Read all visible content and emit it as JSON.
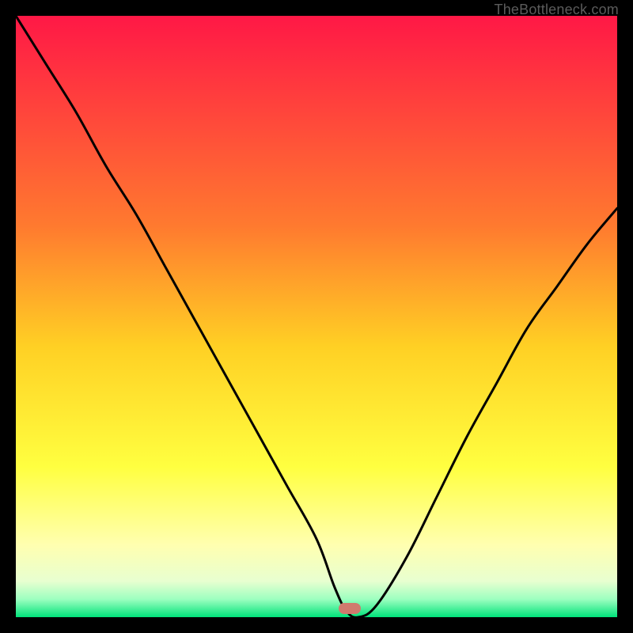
{
  "watermark": "TheBottleneck.com",
  "chart_data": {
    "type": "line",
    "title": "",
    "xlabel": "",
    "ylabel": "",
    "xlim": [
      0,
      100
    ],
    "ylim": [
      0,
      100
    ],
    "gradient_stops": [
      {
        "offset": 0,
        "color": "#ff1846"
      },
      {
        "offset": 35,
        "color": "#ff7a2f"
      },
      {
        "offset": 55,
        "color": "#ffd024"
      },
      {
        "offset": 75,
        "color": "#ffff40"
      },
      {
        "offset": 88,
        "color": "#ffffb0"
      },
      {
        "offset": 94,
        "color": "#e8ffd0"
      },
      {
        "offset": 97,
        "color": "#9dffc0"
      },
      {
        "offset": 100,
        "color": "#00e37a"
      }
    ],
    "series": [
      {
        "name": "bottleneck-curve",
        "x": [
          0,
          5,
          10,
          15,
          20,
          25,
          30,
          35,
          40,
          45,
          50,
          53,
          55,
          57,
          60,
          65,
          70,
          75,
          80,
          85,
          90,
          95,
          100
        ],
        "values": [
          100,
          92,
          84,
          75,
          67,
          58,
          49,
          40,
          31,
          22,
          13,
          5,
          1,
          0,
          2,
          10,
          20,
          30,
          39,
          48,
          55,
          62,
          68
        ]
      }
    ],
    "annotations": [
      {
        "name": "optimum-marker",
        "x": 55.5,
        "y": 1.5,
        "color": "#d07a6e"
      }
    ]
  }
}
